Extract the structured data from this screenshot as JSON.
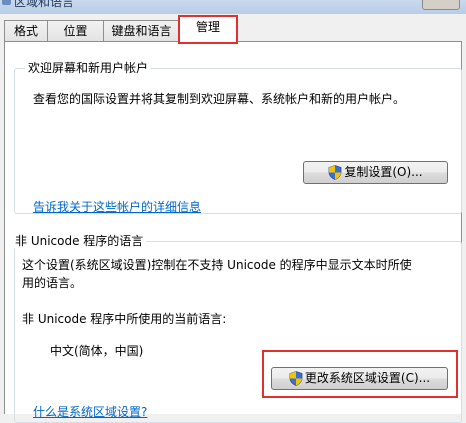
{
  "window": {
    "title": "区域和语言"
  },
  "tabs": [
    {
      "label": "格式"
    },
    {
      "label": "位置"
    },
    {
      "label": "键盘和语言"
    },
    {
      "label": "管理"
    }
  ],
  "welcome": {
    "group_label": "欢迎屏幕和新用户帐户",
    "description": "查看您的国际设置并将其复制到欢迎屏幕、系统帐户和新的用户帐户。",
    "copy_button": "复制设置(O)...",
    "details_link": "告诉我关于这些帐户的详细信息"
  },
  "nonunicode": {
    "group_label": "非 Unicode 程序的语言",
    "description_line1": "这个设置(系统区域设置)控制在不支持 Unicode 的程序中显示文本时所使",
    "description_line2": "用的语言。",
    "current_label": "非 Unicode 程序中所使用的当前语言:",
    "current_value": "中文(简体，中国)",
    "change_button": "更改系统区域设置(C)...",
    "what_link": "什么是系统区域设置?"
  },
  "colors": {
    "highlight": "#e03030",
    "link": "#0066cc",
    "shield_blue": "#3a6fd0",
    "shield_yellow": "#f5c400"
  }
}
